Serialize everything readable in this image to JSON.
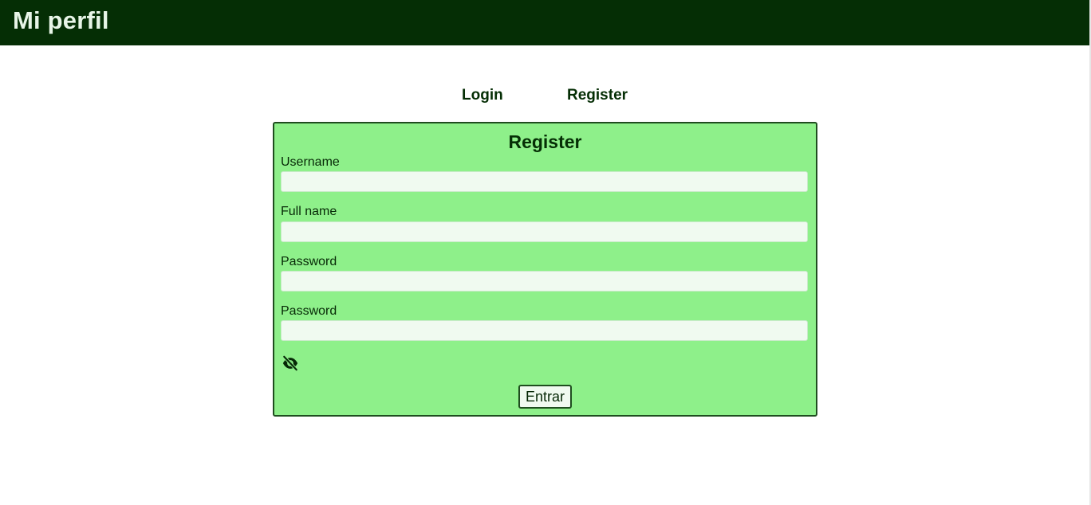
{
  "header": {
    "title": "Mi perfil"
  },
  "tabs": [
    {
      "label": "Login"
    },
    {
      "label": "Register"
    }
  ],
  "form": {
    "title": "Register",
    "fields": [
      {
        "label": "Username",
        "value": ""
      },
      {
        "label": "Full name",
        "value": ""
      },
      {
        "label": "Password",
        "value": ""
      },
      {
        "label": "Password",
        "value": ""
      }
    ],
    "visibility_icon": "eye-slash-icon",
    "submit_label": "Entrar"
  },
  "colors": {
    "header_bg": "#052e05",
    "panel_bg": "#8ef08a",
    "panel_border": "#1f4d1f",
    "input_bg": "#f0faf0"
  }
}
